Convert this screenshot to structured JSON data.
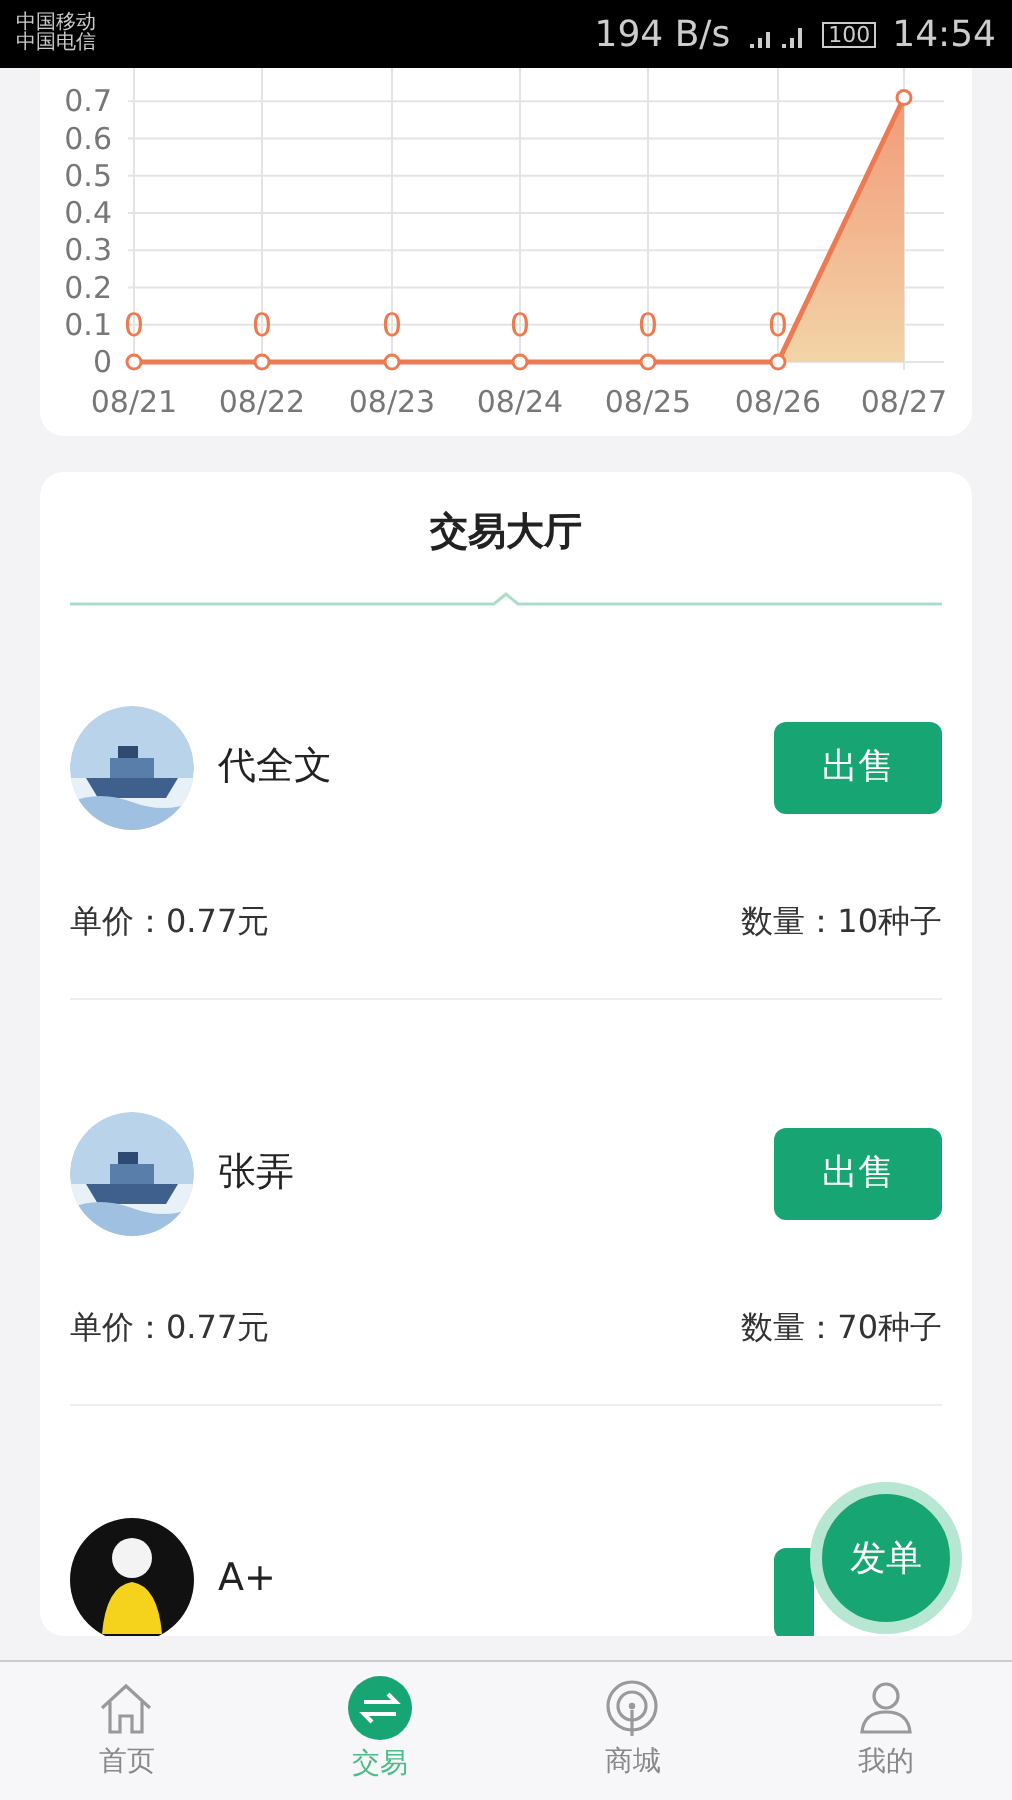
{
  "status_bar": {
    "carriers": [
      "中国移动",
      "中国电信"
    ],
    "speed": "194 B/s",
    "battery": "100",
    "time": "14:54"
  },
  "chart": {
    "chart_data": {
      "type": "area",
      "grid": true,
      "categories": [
        "08/21",
        "08/22",
        "08/23",
        "08/24",
        "08/25",
        "08/26",
        "08/27"
      ],
      "series": [
        {
          "color": "#ee7a52",
          "values": [
            0,
            0,
            0,
            0,
            0,
            0,
            0.71
          ]
        }
      ],
      "ylim": [
        0,
        0.8
      ],
      "yticks": [
        0,
        0.1,
        0.2,
        0.3,
        0.4,
        0.5,
        0.6,
        0.7
      ],
      "value_labels": [
        "0",
        "0",
        "0",
        "0",
        "0",
        "0",
        null
      ]
    }
  },
  "hall": {
    "title": "交易大厅",
    "fab": "发单",
    "orders": [
      {
        "kind": "boat",
        "name": "代全文",
        "action": "出售",
        "price": "单价：0.77元",
        "quantity": "数量：10种子"
      },
      {
        "kind": "boat",
        "name": "张弄",
        "action": "出售",
        "price": "单价：0.77元",
        "quantity": "数量：70种子"
      },
      {
        "kind": "figure",
        "name": "A+"
      }
    ]
  },
  "nav": [
    {
      "kind": "home",
      "label": "首页",
      "selected": false
    },
    {
      "kind": "swap",
      "label": "交易",
      "selected": true
    },
    {
      "kind": "broadcast",
      "label": "商城",
      "selected": false
    },
    {
      "kind": "user",
      "label": "我的",
      "selected": false
    }
  ]
}
